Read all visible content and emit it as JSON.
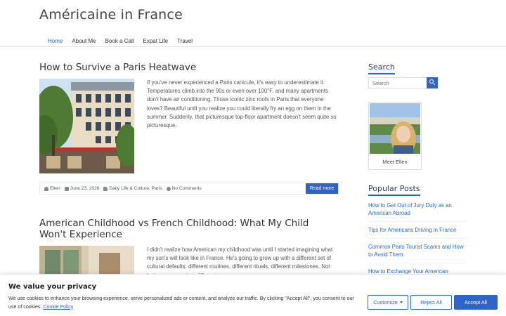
{
  "site": {
    "title": "Américaine in France"
  },
  "nav": {
    "items": [
      {
        "label": "Home",
        "active": true
      },
      {
        "label": "About Me"
      },
      {
        "label": "Book a Call"
      },
      {
        "label": "Expat Life"
      },
      {
        "label": "Travel"
      }
    ]
  },
  "posts": [
    {
      "title": "How to Survive a Paris Heatwave",
      "excerpt": "If you've never experienced a Paris canicule, it's easy to underestimate it. Temperatures climb into the 90s or even over 100°F, and many apartments don't have air conditioning. Those iconic zinc roofs in Paris that everyone loves? Beautiful until you realize you could literally fry an egg on them in the summer. Suddenly, that picturesque top-floor apartment doesn't seem quite so picturesque.",
      "meta": {
        "author": "Ellen",
        "date": "June 23, 2026",
        "categories": "Daily Life & Culture, Paris",
        "comments": "No Comments"
      },
      "read_more": "Read more"
    },
    {
      "title": "American Childhood vs French Childhood: What My Child Won't Experience",
      "excerpt": "I didn't realize how American my childhood was until I started imagining what my son's will look like in France. He's going to grow up with a different set of cultural defaults: different routines, different rituals, different milestones. Not better or worse, just different."
    }
  ],
  "sidebar": {
    "search_title": "Search",
    "search_placeholder": "Search",
    "profile_caption": "Meet Ellen",
    "popular_title": "Popular Posts",
    "popular": [
      "How to Get Out of Jury Duty as an American Abroad",
      "Tips for Americans Driving in France",
      "Common Paris Tourist Scams and How to Avoid Them",
      "How to Exchange Your American Driver's License in France"
    ]
  },
  "cookie": {
    "title": "We value your privacy",
    "text": "We use cookies to enhance your browsing experience, serve personalized ads or content, and analyze our traffic. By clicking \"Accept All\", you consent to our use of cookies.",
    "link": "Cookie Policy",
    "customize": "Customize",
    "reject": "Reject All",
    "accept": "Accept All"
  },
  "colors": {
    "accent": "#2e64c5",
    "link": "#2b6bc0"
  }
}
